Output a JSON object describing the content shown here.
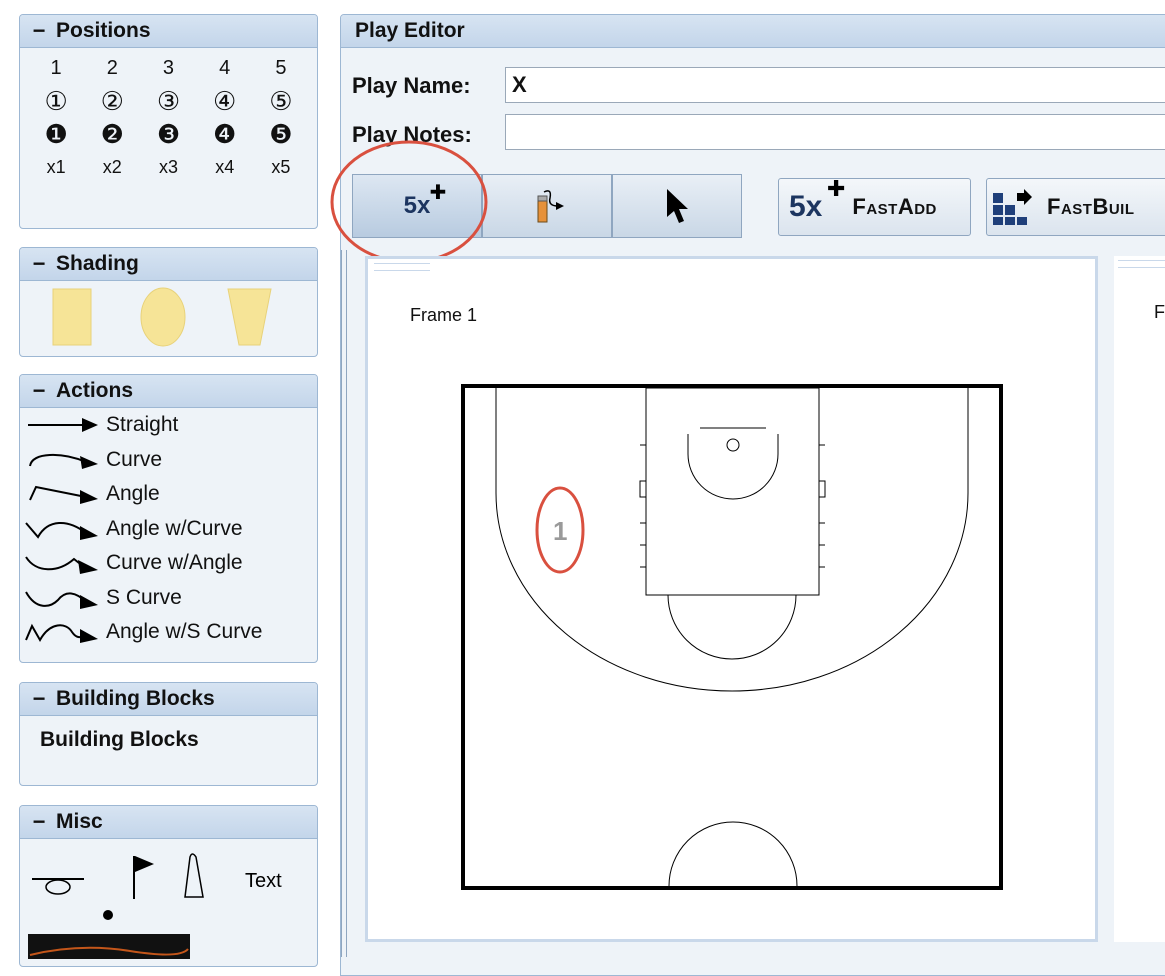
{
  "positions": {
    "title": "Positions",
    "numbers": [
      "1",
      "2",
      "3",
      "4",
      "5"
    ],
    "circled": [
      "①",
      "②",
      "③",
      "④",
      "⑤"
    ],
    "dark": [
      "❶",
      "❷",
      "❸",
      "❹",
      "❺"
    ],
    "x_labels": [
      "x1",
      "x2",
      "x3",
      "x4",
      "x5"
    ]
  },
  "shading": {
    "title": "Shading",
    "fill_color": "#f6e497"
  },
  "actions": {
    "title": "Actions",
    "items": [
      "Straight",
      "Curve",
      "Angle",
      "Angle w/Curve",
      "Curve w/Angle",
      "S Curve",
      "Angle w/S Curve"
    ]
  },
  "building_blocks": {
    "title": "Building Blocks",
    "item": "Building Blocks"
  },
  "misc": {
    "title": "Misc",
    "text_label": "Text"
  },
  "editor": {
    "title": "Play Editor",
    "play_name_label": "Play Name:",
    "play_name_value": "X",
    "play_notes_label": "Play Notes:",
    "play_notes_value": "",
    "toolbar": {
      "add_five_label": "5x",
      "fast_add_label": "FastAdd",
      "fast_build_label": "FastBuil"
    },
    "frames": [
      {
        "label": "Frame 1",
        "player_marker": "1"
      },
      {
        "label": "F"
      }
    ]
  },
  "colors": {
    "panel_header": "#c9d9ec",
    "annotation_red": "#d9503f",
    "shade_yellow": "#f6e497"
  }
}
